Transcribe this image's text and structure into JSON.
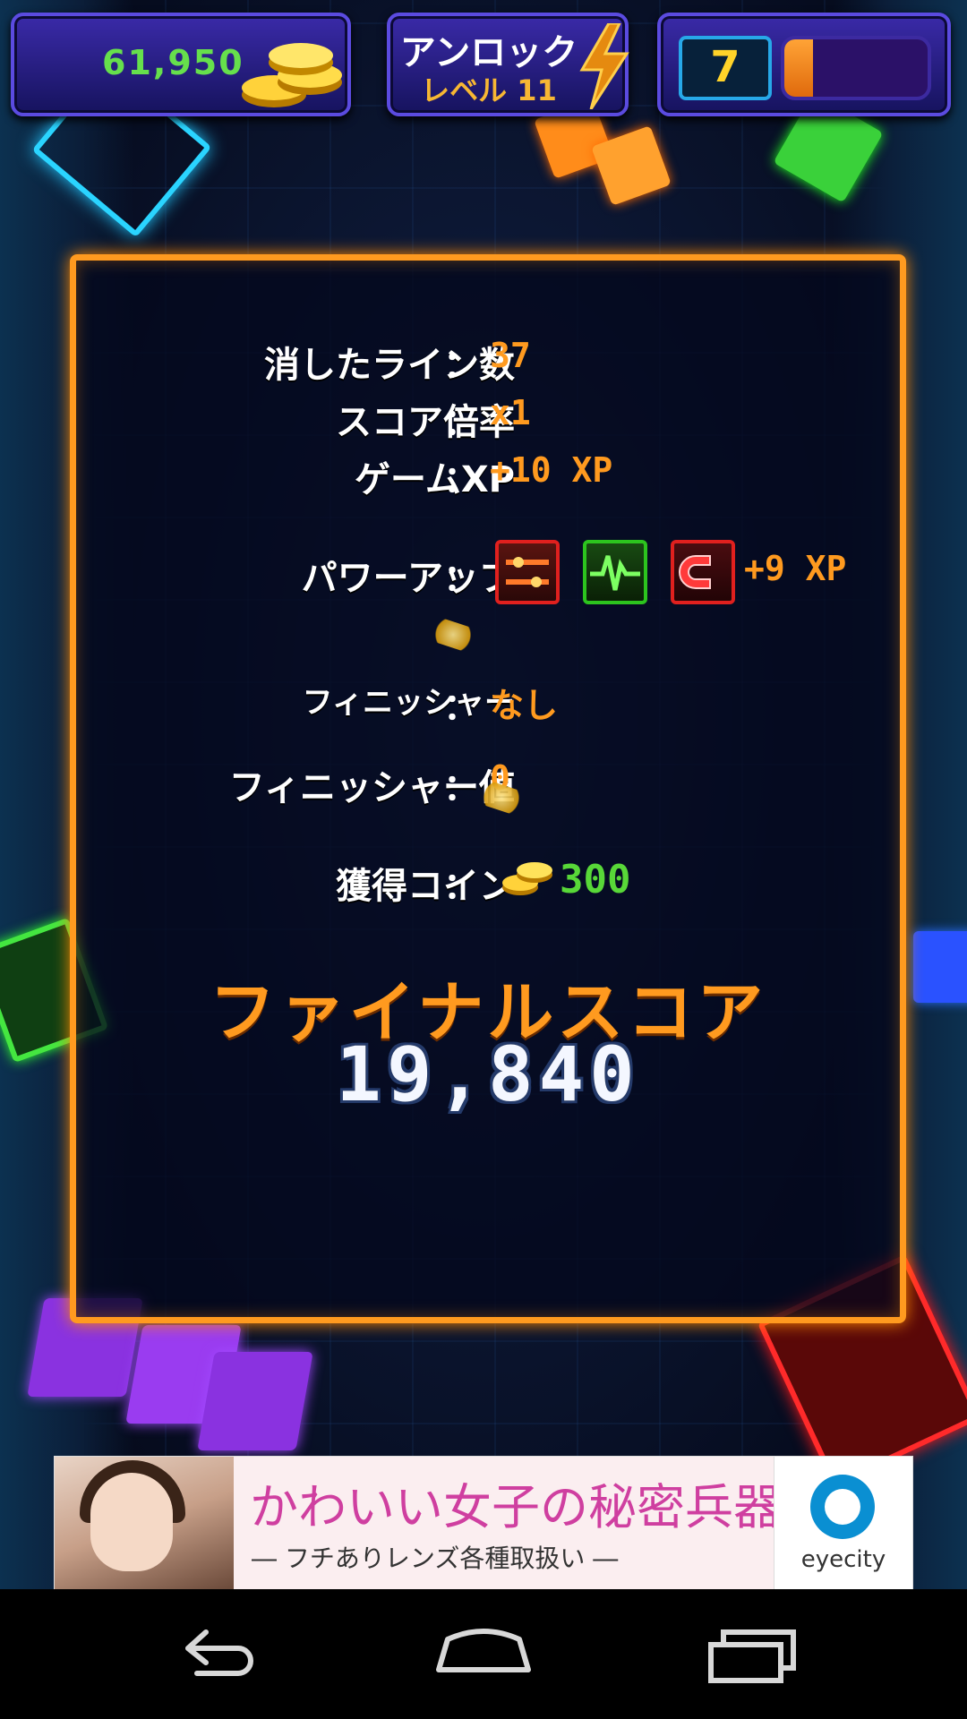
{
  "hud": {
    "coins": "61,950",
    "unlock_title": "アンロック",
    "unlock_level": "レベル 11",
    "player_level": "7",
    "xp_progress": 0.2
  },
  "stats": {
    "lines_label": "消したライン数",
    "lines_value": "37",
    "multiplier_label": "スコア倍率",
    "multiplier_value": "x1",
    "game_xp_label": "ゲームXP",
    "game_xp_value": "+10 XP",
    "powerups_label": "パワーアップ",
    "powerups": [
      "laser-icon",
      "pulse-icon",
      "magnet-icon"
    ],
    "powerups_xp": "+9 XP",
    "finisher_label": "フィニッシャー",
    "finisher_value": "なし",
    "finisher_score_label": "フィニッシャー値",
    "finisher_score_value": "0",
    "coins_earned_label": "獲得コイン",
    "coins_earned_value": "300",
    "colon": "："
  },
  "final": {
    "title": "ファイナルスコア",
    "score": "19,840"
  },
  "ad": {
    "headline": "かわいい女子の秘密兵器",
    "subline": "― フチありレンズ各種取扱い ―",
    "brand": "eyecity"
  },
  "colors": {
    "panel_border": "#ff9a1f",
    "value_orange": "#ff9a1f",
    "coins_green": "#66e04c",
    "hud_purple": "#3a2aa8"
  }
}
